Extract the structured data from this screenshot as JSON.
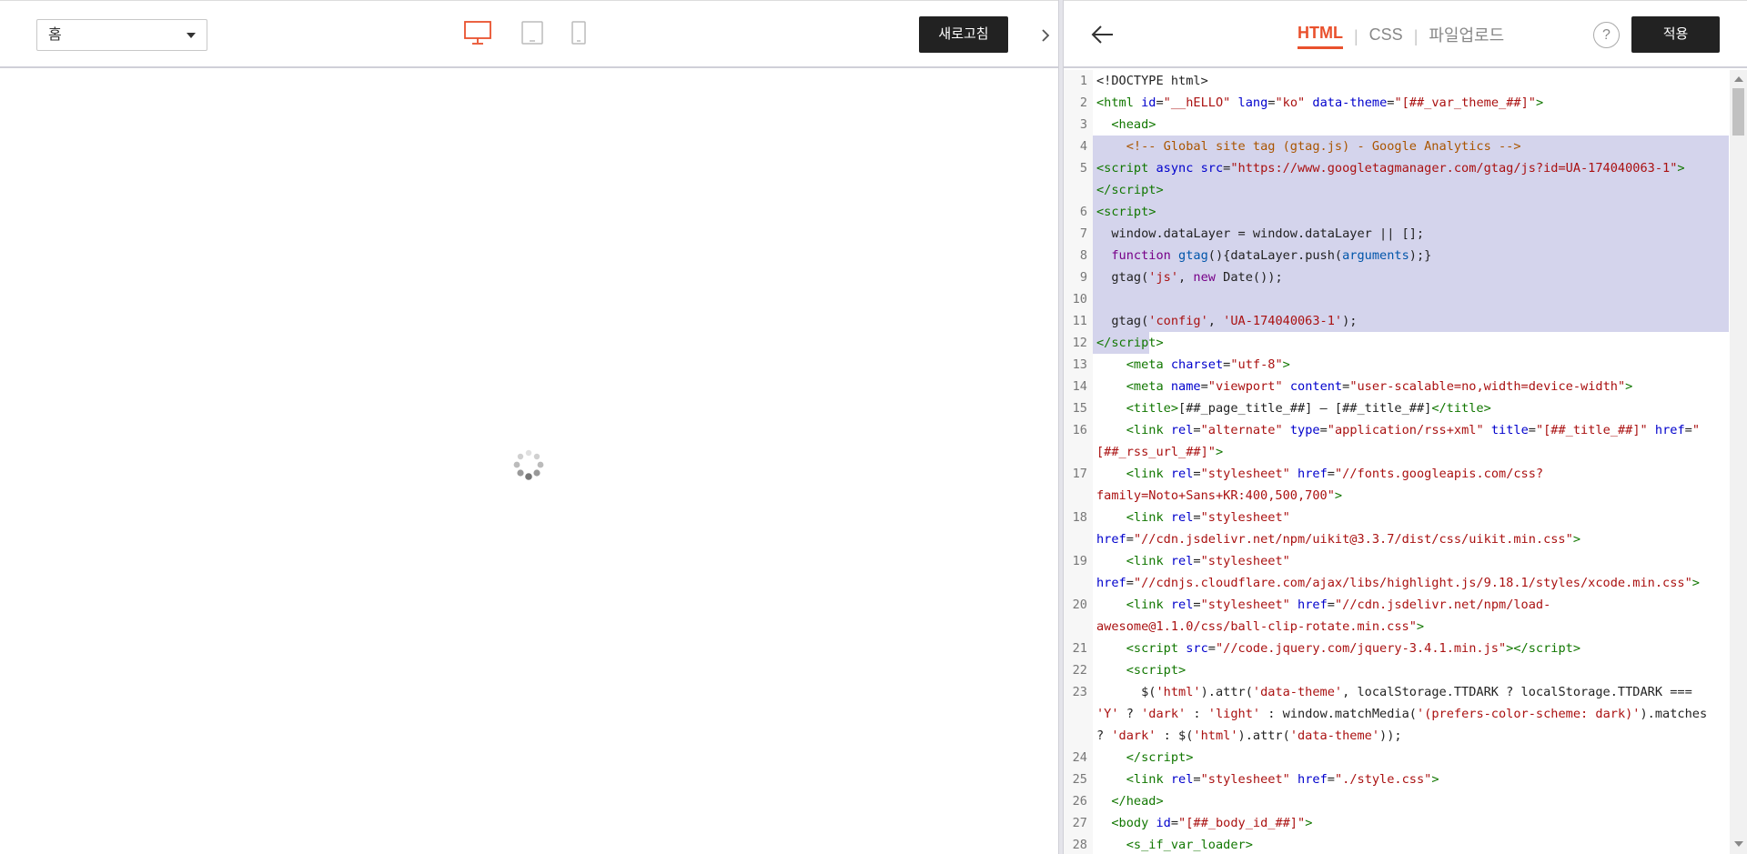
{
  "preview": {
    "page_select": "홈",
    "refresh_label": "새로고침",
    "devices": [
      "desktop-icon",
      "tablet-icon",
      "mobile-icon"
    ],
    "active_device": "desktop-icon",
    "accent_color": "#e9512d"
  },
  "editor": {
    "tabs": [
      "HTML",
      "CSS",
      "파일업로드"
    ],
    "active_tab": "HTML",
    "help_label": "?",
    "apply_label": "적용",
    "code_lines": [
      {
        "n": "1",
        "html": "&lt;!DOCTYPE html&gt;"
      },
      {
        "n": "2",
        "html": "<span class='t-tag'>&lt;html</span> <span class='t-attr'>id</span>=<span class='t-str'>\"__hELLO\"</span> <span class='t-attr'>lang</span>=<span class='t-str'>\"ko\"</span> <span class='t-attr'>data-theme</span>=<span class='t-str'>\"[##_var_theme_##]\"</span><span class='t-tag'>&gt;</span>"
      },
      {
        "n": "3",
        "html": "  <span class='t-tag'>&lt;head&gt;</span>"
      },
      {
        "n": "4",
        "sel": true,
        "html": "    <span class='t-com'>&lt;!-- Global site tag (gtag.js) - Google Analytics --&gt;</span>"
      },
      {
        "n": "5",
        "sel": true,
        "html": "<span class='t-tag'>&lt;script</span> <span class='t-attr'>async</span> <span class='t-attr'>src</span>=<span class='t-str'>\"https://www.googletagmanager.com/gtag/js?id=UA-174040063-1\"</span><span class='t-tag'>&gt;</span>"
      },
      {
        "n": "",
        "sel": true,
        "cont": true,
        "html": "<span class='t-tag'>&lt;/script&gt;</span>"
      },
      {
        "n": "6",
        "sel": true,
        "html": "<span class='t-tag'>&lt;script&gt;</span>"
      },
      {
        "n": "7",
        "sel": true,
        "html": "  window.dataLayer = window.dataLayer || [];"
      },
      {
        "n": "8",
        "sel": true,
        "html": "  <span class='t-kw'>function</span> <span class='t-var'>gtag</span>(){dataLayer.push(<span class='t-var'>arguments</span>);}"
      },
      {
        "n": "9",
        "sel": true,
        "html": "  gtag(<span class='t-str'>'js'</span>, <span class='t-kw'>new</span> Date());"
      },
      {
        "n": "10",
        "sel": true,
        "html": " "
      },
      {
        "n": "11",
        "sel": true,
        "html": "  gtag(<span class='t-str'>'config'</span>, <span class='t-str'>'UA-174040063-1'</span>);"
      },
      {
        "n": "12",
        "selpart": true,
        "html": "<span class='t-tag'>&lt;/script&gt;</span>"
      },
      {
        "n": "13",
        "html": "    <span class='t-tag'>&lt;meta</span> <span class='t-attr'>charset</span>=<span class='t-str'>\"utf-8\"</span><span class='t-tag'>&gt;</span>"
      },
      {
        "n": "14",
        "html": "    <span class='t-tag'>&lt;meta</span> <span class='t-attr'>name</span>=<span class='t-str'>\"viewport\"</span> <span class='t-attr'>content</span>=<span class='t-str'>\"user-scalable=no,width=device-width\"</span><span class='t-tag'>&gt;</span>"
      },
      {
        "n": "15",
        "html": "    <span class='t-tag'>&lt;title&gt;</span>[##_page_title_##] — [##_title_##]<span class='t-tag'>&lt;/title&gt;</span>"
      },
      {
        "n": "16",
        "html": "    <span class='t-tag'>&lt;link</span> <span class='t-attr'>rel</span>=<span class='t-str'>\"alternate\"</span> <span class='t-attr'>type</span>=<span class='t-str'>\"application/rss+xml\"</span> <span class='t-attr'>title</span>=<span class='t-str'>\"[##_title_##]\"</span> <span class='t-attr'>href</span>=<span class='t-str'>\"</span>"
      },
      {
        "n": "",
        "cont": true,
        "html": "<span class='t-str'>[##_rss_url_##]\"</span><span class='t-tag'>&gt;</span>"
      },
      {
        "n": "17",
        "html": "    <span class='t-tag'>&lt;link</span> <span class='t-attr'>rel</span>=<span class='t-str'>\"stylesheet\"</span> <span class='t-attr'>href</span>=<span class='t-str'>\"//fonts.googleapis.com/css?</span>"
      },
      {
        "n": "",
        "cont": true,
        "html": "<span class='t-str'>family=Noto+Sans+KR:400,500,700\"</span><span class='t-tag'>&gt;</span>"
      },
      {
        "n": "18",
        "html": "    <span class='t-tag'>&lt;link</span> <span class='t-attr'>rel</span>=<span class='t-str'>\"stylesheet\"</span>"
      },
      {
        "n": "",
        "cont": true,
        "html": "<span class='t-attr'>href</span>=<span class='t-str'>\"//cdn.jsdelivr.net/npm/uikit@3.3.7/dist/css/uikit.min.css\"</span><span class='t-tag'>&gt;</span>"
      },
      {
        "n": "19",
        "html": "    <span class='t-tag'>&lt;link</span> <span class='t-attr'>rel</span>=<span class='t-str'>\"stylesheet\"</span>"
      },
      {
        "n": "",
        "cont": true,
        "html": "<span class='t-attr'>href</span>=<span class='t-str'>\"//cdnjs.cloudflare.com/ajax/libs/highlight.js/9.18.1/styles/xcode.min.css\"</span><span class='t-tag'>&gt;</span>"
      },
      {
        "n": "20",
        "html": "    <span class='t-tag'>&lt;link</span> <span class='t-attr'>rel</span>=<span class='t-str'>\"stylesheet\"</span> <span class='t-attr'>href</span>=<span class='t-str'>\"//cdn.jsdelivr.net/npm/load-</span>"
      },
      {
        "n": "",
        "cont": true,
        "html": "<span class='t-str'>awesome@1.1.0/css/ball-clip-rotate.min.css\"</span><span class='t-tag'>&gt;</span>"
      },
      {
        "n": "21",
        "html": "    <span class='t-tag'>&lt;script</span> <span class='t-attr'>src</span>=<span class='t-str'>\"//code.jquery.com/jquery-3.4.1.min.js\"</span><span class='t-tag'>&gt;&lt;/script&gt;</span>"
      },
      {
        "n": "22",
        "html": "    <span class='t-tag'>&lt;script&gt;</span>"
      },
      {
        "n": "23",
        "html": "      $(<span class='t-str'>'html'</span>).attr(<span class='t-str'>'data-theme'</span>, localStorage.TTDARK ? localStorage.TTDARK ==="
      },
      {
        "n": "",
        "cont": true,
        "html": "<span class='t-str'>'Y'</span> ? <span class='t-str'>'dark'</span> : <span class='t-str'>'light'</span> : window.matchMedia(<span class='t-str'>'(prefers-color-scheme: dark)'</span>).matches"
      },
      {
        "n": "",
        "cont": true,
        "html": "? <span class='t-str'>'dark'</span> : $(<span class='t-str'>'html'</span>).attr(<span class='t-str'>'data-theme'</span>));"
      },
      {
        "n": "24",
        "html": "    <span class='t-tag'>&lt;/script&gt;</span>"
      },
      {
        "n": "25",
        "html": "    <span class='t-tag'>&lt;link</span> <span class='t-attr'>rel</span>=<span class='t-str'>\"stylesheet\"</span> <span class='t-attr'>href</span>=<span class='t-str'>\"./style.css\"</span><span class='t-tag'>&gt;</span>"
      },
      {
        "n": "26",
        "html": "  <span class='t-tag'>&lt;/head&gt;</span>"
      },
      {
        "n": "27",
        "html": "  <span class='t-tag'>&lt;body</span> <span class='t-attr'>id</span>=<span class='t-str'>\"[##_body_id_##]\"</span><span class='t-tag'>&gt;</span>"
      },
      {
        "n": "28",
        "html": "    <span class='t-tag'>&lt;s_if_var_loader&gt;</span>"
      }
    ]
  }
}
